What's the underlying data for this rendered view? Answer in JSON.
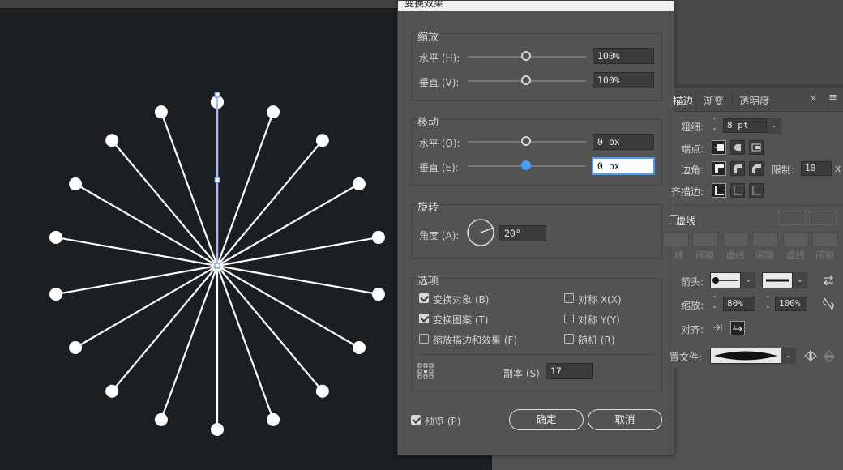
{
  "dialog": {
    "title": "变换效果",
    "scale": {
      "label": "缩放",
      "horizontal": {
        "label": "水平 (H):",
        "value": "100%"
      },
      "vertical": {
        "label": "垂直 (V):",
        "value": "100%"
      }
    },
    "move": {
      "label": "移动",
      "horizontal": {
        "label": "水平 (O):",
        "value": "0 px"
      },
      "vertical": {
        "label": "垂直 (E):",
        "value": "0 px"
      }
    },
    "rotate": {
      "label": "旋转",
      "angle_label": "角度 (A):",
      "angle_value": "20°"
    },
    "options": {
      "label": "选项",
      "transform_objects": "变换对象 (B)",
      "transform_patterns": "变换图案 (T)",
      "scale_strokes": "缩放描边和效果 (F)",
      "reflect_x": "对称 X(X)",
      "reflect_y": "对称 Y(Y)",
      "random": "随机 (R)",
      "copies_label": "副本 (S)",
      "copies_value": "17"
    },
    "preview_label": "预览 (P)",
    "ok_label": "确定",
    "cancel_label": "取消"
  },
  "stroke_panel": {
    "tabs": [
      "描边",
      "渐变",
      "透明度"
    ],
    "weight_label": "粗细:",
    "weight_value": "8 pt",
    "cap_label": "端点:",
    "corner_label": "边角:",
    "limit_label": "限制:",
    "limit_value": "10",
    "limit_suffix": "x",
    "align_label": "齐描边:",
    "dashed_label": "虚线",
    "dash_labels": [
      "线",
      "间隙",
      "虚线",
      "间隙",
      "虚线",
      "间隙"
    ],
    "arrow_label": "箭头:",
    "scale_label": "缩放:",
    "scale_start": "80%",
    "scale_end": "100%",
    "align_arrow_label": "对齐:",
    "profile_label": "置文件:"
  },
  "canvas": {
    "spoke_count": 18,
    "angle_step": 20,
    "background": "#1c1f21",
    "stroke_color": "#ffffff",
    "selection_color": "#4a7bff"
  }
}
